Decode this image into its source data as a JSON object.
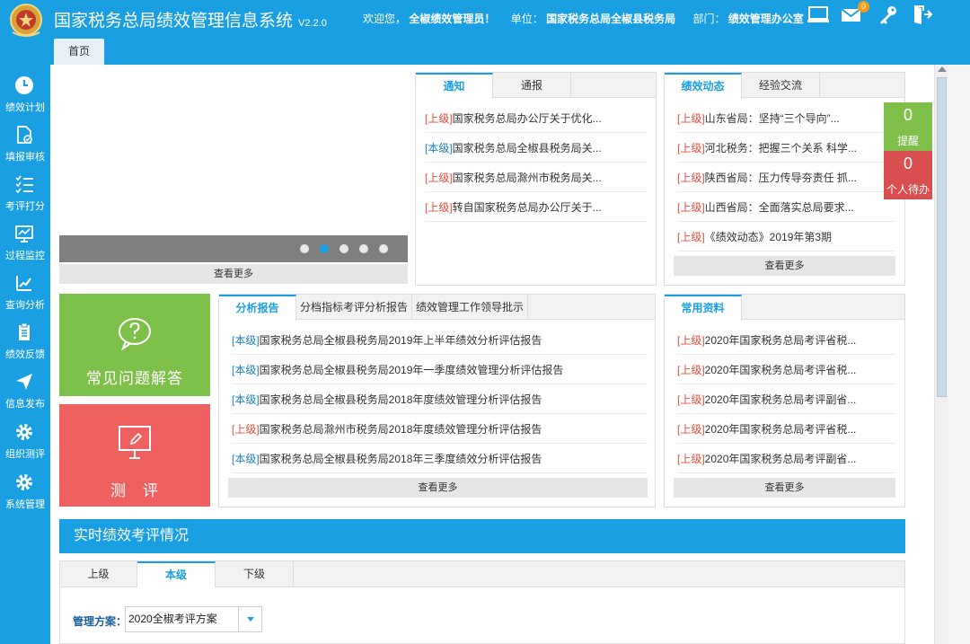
{
  "header": {
    "title": "国家税务总局绩效管理信息系统",
    "version": "V2.2.0",
    "welcome_prefix": "欢迎您，",
    "user": "全椒绩效管理员！",
    "unit_label": "单位：",
    "unit": "国家税务总局全椒县税务局",
    "dept_label": "部门：",
    "dept": "绩效管理办公室",
    "mail_count": "0",
    "home_tab": "首页"
  },
  "sidebar": {
    "items": [
      {
        "label": "绩效计划",
        "icon": "clock-icon"
      },
      {
        "label": "填报审核",
        "icon": "doc-check-icon"
      },
      {
        "label": "考评打分",
        "icon": "checklist-icon"
      },
      {
        "label": "过程监控",
        "icon": "monitor-chart-icon"
      },
      {
        "label": "查询分析",
        "icon": "analysis-icon"
      },
      {
        "label": "绩效反馈",
        "icon": "clipboard-icon"
      },
      {
        "label": "信息发布",
        "icon": "send-icon"
      },
      {
        "label": "组织测评",
        "icon": "gear-icon"
      },
      {
        "label": "系统管理",
        "icon": "gear-icon"
      }
    ]
  },
  "banner": {
    "more": "查看更多",
    "dot_count": 5,
    "active_dot": 1
  },
  "notice_panel": {
    "tabs": [
      "通知",
      "通报"
    ],
    "items": [
      {
        "tag": "[上级]",
        "level": "up",
        "text": "国家税务总局办公厅关于优化..."
      },
      {
        "tag": "[本级]",
        "level": "cur",
        "text": "国家税务总局全椒县税务局关..."
      },
      {
        "tag": "[上级]",
        "level": "up",
        "text": "国家税务总局滁州市税务局关..."
      },
      {
        "tag": "[上级]",
        "level": "up",
        "text": "转自国家税务总局办公厅关于..."
      }
    ]
  },
  "news_panel": {
    "tabs": [
      "绩效动态",
      "经验交流"
    ],
    "items": [
      {
        "tag": "[上级]",
        "level": "up",
        "text": "山东省局：坚持“三个导向”..."
      },
      {
        "tag": "[上级]",
        "level": "up",
        "text": "河北税务：把握三个关系 科学..."
      },
      {
        "tag": "[上级]",
        "level": "up",
        "text": "陕西省局：压力传导夯责任 抓..."
      },
      {
        "tag": "[上级]",
        "level": "up",
        "text": "山西省局：全面落实总局要求..."
      },
      {
        "tag": "[上级]",
        "level": "up",
        "text": "《绩效动态》2019年第3期"
      }
    ],
    "more": "查看更多"
  },
  "counters": {
    "remind_count": "0",
    "remind_label": "提醒",
    "todo_count": "0",
    "todo_label": "个人待办"
  },
  "tiles": {
    "faq": "常见问题解答",
    "eval": "测　评"
  },
  "analysis_panel": {
    "tabs": [
      "分析报告",
      "分档指标考评分析报告",
      "绩效管理工作领导批示"
    ],
    "items": [
      {
        "tag": "[本级]",
        "level": "cur",
        "text": "国家税务总局全椒县税务局2019年上半年绩效分析评估报告"
      },
      {
        "tag": "[本级]",
        "level": "cur",
        "text": "国家税务总局全椒县税务局2019年一季度绩效管理分析评估报告"
      },
      {
        "tag": "[本级]",
        "level": "cur",
        "text": "国家税务总局全椒县税务局2018年度绩效管理分析评估报告"
      },
      {
        "tag": "[上级]",
        "level": "up",
        "text": "国家税务总局滁州市税务局2018年度绩效管理分析评估报告"
      },
      {
        "tag": "[本级]",
        "level": "cur",
        "text": "国家税务总局全椒县税务局2018年三季度绩效分析评估报告"
      }
    ],
    "more": "查看更多"
  },
  "resources_panel": {
    "tabs": [
      "常用资料"
    ],
    "items": [
      {
        "tag": "[上级]",
        "level": "up",
        "text": "2020年国家税务总局考评省税..."
      },
      {
        "tag": "[上级]",
        "level": "up",
        "text": "2020年国家税务总局考评省税..."
      },
      {
        "tag": "[上级]",
        "level": "up",
        "text": "2020年国家税务总局考评副省..."
      },
      {
        "tag": "[上级]",
        "level": "up",
        "text": "2020年国家税务总局考评省税..."
      },
      {
        "tag": "[上级]",
        "level": "up",
        "text": "2020年国家税务总局考评副省..."
      }
    ],
    "more": "查看更多"
  },
  "realtime": {
    "title": "实时绩效考评情况",
    "tabs": [
      "上级",
      "本级",
      "下级"
    ],
    "active_tab": 1,
    "plan_label": "管理方案：",
    "plan_value": "2020全椒考评方案"
  },
  "colors": {
    "accent": "#1a9fe3",
    "tag_up": "#e74c3c",
    "tag_cur": "#1a7fc3",
    "green": "#7dc04a",
    "red": "#ef6161"
  }
}
